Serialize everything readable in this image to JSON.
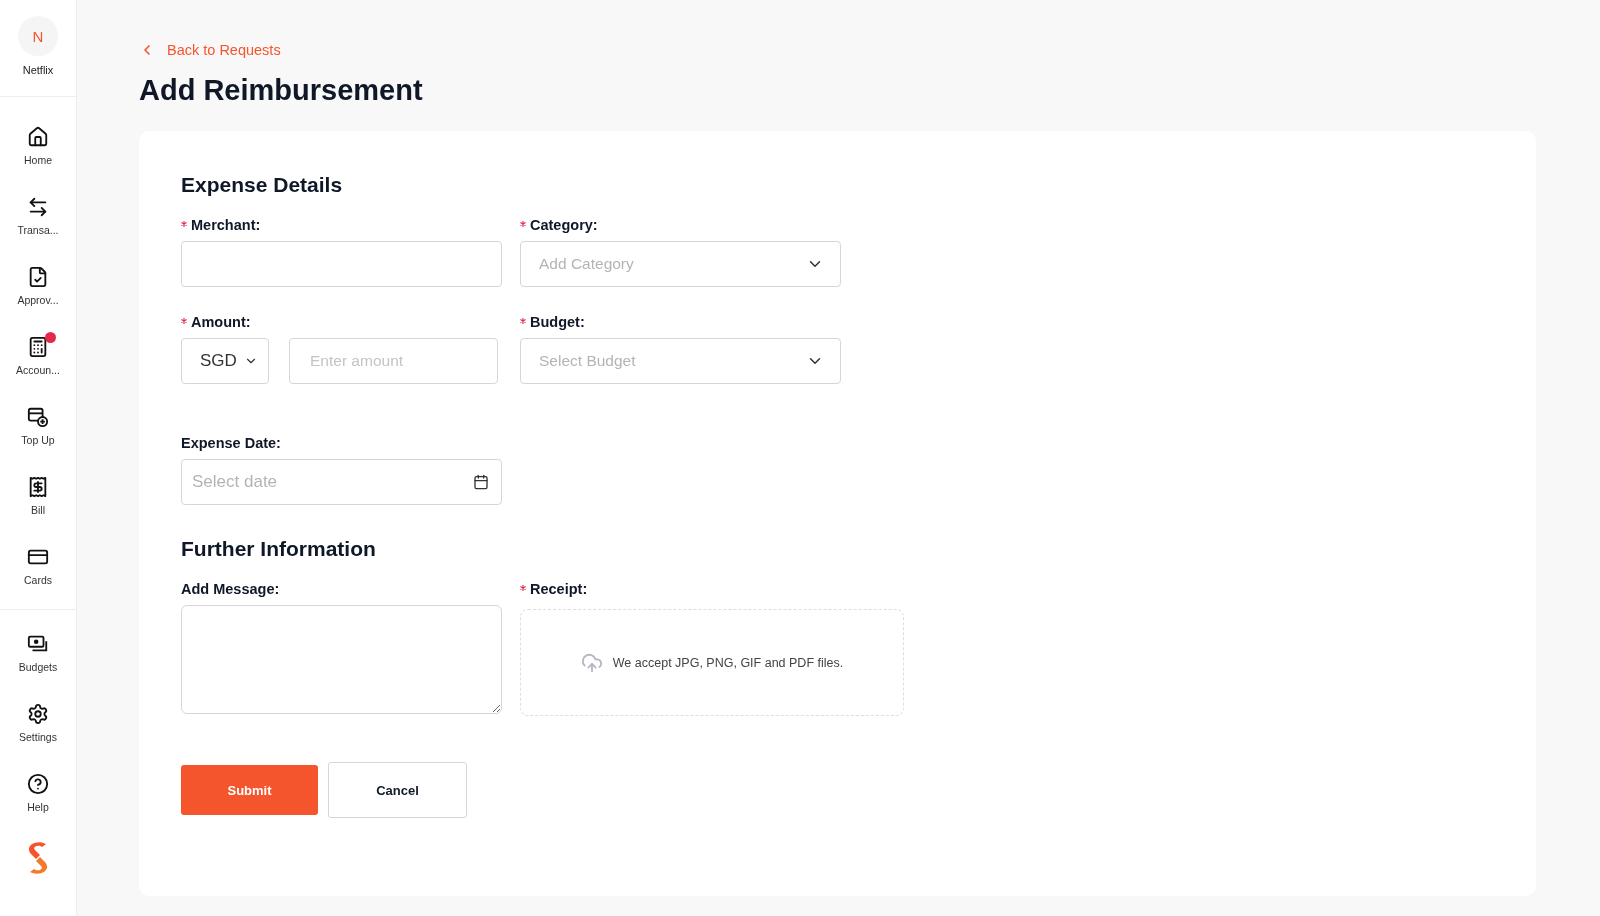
{
  "sidebar": {
    "org": {
      "initial": "N",
      "name": "Netflix"
    },
    "sections": [
      {
        "items": [
          {
            "label": "Home",
            "notification": false
          },
          {
            "label": "Transa...",
            "notification": false
          },
          {
            "label": "Approv...",
            "notification": false
          },
          {
            "label": "Accoun...",
            "notification": true
          },
          {
            "label": "Top Up",
            "notification": false
          },
          {
            "label": "Bill",
            "notification": false
          },
          {
            "label": "Cards",
            "notification": false
          }
        ]
      },
      {
        "items": [
          {
            "label": "Budgets",
            "notification": false
          },
          {
            "label": "Settings",
            "notification": false
          },
          {
            "label": "Help",
            "notification": false
          }
        ]
      }
    ]
  },
  "back_link": "Back to Requests",
  "title": "Add Reimbursement",
  "sections": [
    {
      "title": "Expense Details",
      "fields": [
        {
          "label": "Merchant:",
          "required": true,
          "kind": "text"
        },
        {
          "label": "Category:",
          "required": true,
          "kind": "select",
          "placeholder": "Add Category"
        },
        {
          "label": "Amount:",
          "required": true,
          "kind": "amount",
          "currency": "SGD",
          "placeholder": "Enter amount"
        },
        {
          "label": "Budget:",
          "required": true,
          "kind": "select",
          "placeholder": "Select Budget"
        },
        {
          "label": "Expense Date:",
          "required": false,
          "kind": "date",
          "placeholder": "Select date"
        }
      ]
    },
    {
      "title": "Further Information",
      "fields": [
        {
          "label": "Add Message:",
          "required": false,
          "kind": "textarea"
        },
        {
          "label": "Receipt:",
          "required": true,
          "kind": "upload",
          "hint": "We accept JPG, PNG, GIF and PDF files."
        }
      ]
    }
  ],
  "buttons": [
    {
      "label": "Submit",
      "kind": "primary"
    },
    {
      "label": "Cancel",
      "kind": "secondary"
    }
  ]
}
